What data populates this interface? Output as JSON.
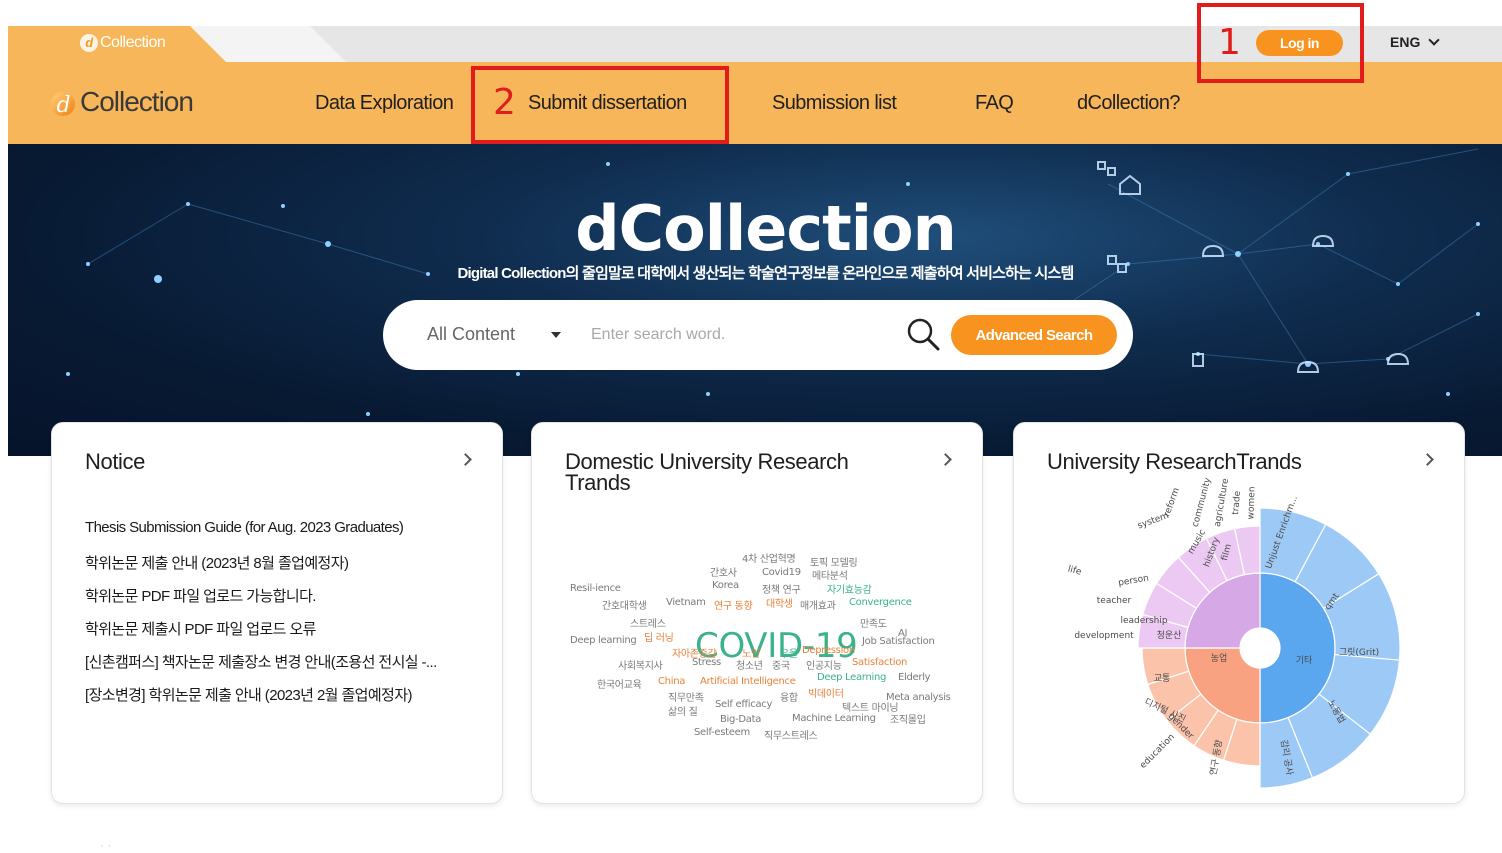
{
  "header": {
    "top_logo": "Collection",
    "login_label": "Log in",
    "language": "ENG"
  },
  "nav": {
    "brand": "Collection",
    "items": [
      "Data Exploration",
      "Submit dissertation",
      "Submission list",
      "FAQ",
      "dCollection?"
    ]
  },
  "annotations": [
    {
      "number": "1",
      "target": "Log in"
    },
    {
      "number": "2",
      "target": "Submit dissertation"
    }
  ],
  "hero": {
    "title": "dCollection",
    "subtitle": "Digital Collection의 줄임말로 대학에서 생산되는 학술연구정보를 온라인으로 제출하여 서비스하는 시스템"
  },
  "search": {
    "scope": "All Content",
    "placeholder": "Enter search word.",
    "advanced_label": "Advanced Search"
  },
  "cards": {
    "notice": {
      "title": "Notice",
      "items": [
        "Thesis Submission Guide (for Aug. 2023 Graduates)",
        "학위논문 제출 안내 (2023년 8월 졸업예정자)",
        "학위논문 PDF 파일 업로드 가능합니다.",
        "학위논문 제출시 PDF 파일 업로드 오류",
        "[신촌캠퍼스] 책자논문 제출장소 변경 안내(조용선 전시실 -...",
        "[장소변경] 학위논문 제출 안내 (2023년 2월 졸업예정자)"
      ]
    },
    "domestic": {
      "title": "Domestic University Research Trands",
      "words": [
        {
          "text": "COVID-19",
          "color": "#3bb28a",
          "size": "big"
        },
        {
          "text": "4차 산업혁명",
          "color": "#7a7a7a"
        },
        {
          "text": "토픽 모델링",
          "color": "#7a7a7a"
        },
        {
          "text": "간호사",
          "color": "#7a7a7a"
        },
        {
          "text": "Covid19",
          "color": "#7a7a7a"
        },
        {
          "text": "메타분석",
          "color": "#7a7a7a"
        },
        {
          "text": "Resil-ience",
          "color": "#7a7a7a"
        },
        {
          "text": "Korea",
          "color": "#7a7a7a"
        },
        {
          "text": "정책 연구",
          "color": "#7a7a7a"
        },
        {
          "text": "자기효능감",
          "color": "#3bb28a"
        },
        {
          "text": "간호대학생",
          "color": "#7a7a7a"
        },
        {
          "text": "Vietnam",
          "color": "#7a7a7a"
        },
        {
          "text": "연구 동향",
          "color": "#e8823c"
        },
        {
          "text": "대학생",
          "color": "#e8823c"
        },
        {
          "text": "매개효과",
          "color": "#7a7a7a"
        },
        {
          "text": "Convergence",
          "color": "#3bb28a"
        },
        {
          "text": "스트레스",
          "color": "#7a7a7a"
        },
        {
          "text": "만족도",
          "color": "#7a7a7a"
        },
        {
          "text": "Deep learning",
          "color": "#7a7a7a"
        },
        {
          "text": "딥 러닝",
          "color": "#e8823c"
        },
        {
          "text": "AI",
          "color": "#7a7a7a"
        },
        {
          "text": "Job Satisfaction",
          "color": "#7a7a7a"
        },
        {
          "text": "자아존중감",
          "color": "#e8823c"
        },
        {
          "text": "노인",
          "color": "#e8823c"
        },
        {
          "text": "우울",
          "color": "#3bb28a"
        },
        {
          "text": "Depression",
          "color": "#e8823c"
        },
        {
          "text": "사회복지사",
          "color": "#7a7a7a"
        },
        {
          "text": "Stress",
          "color": "#7a7a7a"
        },
        {
          "text": "청소년",
          "color": "#7a7a7a"
        },
        {
          "text": "중국",
          "color": "#7a7a7a"
        },
        {
          "text": "인공지능",
          "color": "#7a7a7a"
        },
        {
          "text": "Satisfaction",
          "color": "#e8823c"
        },
        {
          "text": "한국어교육",
          "color": "#7a7a7a"
        },
        {
          "text": "China",
          "color": "#e8823c"
        },
        {
          "text": "Artificial Intelligence",
          "color": "#e8823c"
        },
        {
          "text": "Deep Learning",
          "color": "#3bb28a"
        },
        {
          "text": "Elderly",
          "color": "#7a7a7a"
        },
        {
          "text": "직무만족",
          "color": "#7a7a7a"
        },
        {
          "text": "융합",
          "color": "#7a7a7a"
        },
        {
          "text": "빅데이터",
          "color": "#e8823c"
        },
        {
          "text": "삶의 질",
          "color": "#7a7a7a"
        },
        {
          "text": "Self efficacy",
          "color": "#7a7a7a"
        },
        {
          "text": "텍스트 마이닝",
          "color": "#7a7a7a"
        },
        {
          "text": "Meta analysis",
          "color": "#7a7a7a"
        },
        {
          "text": "Big-Data",
          "color": "#7a7a7a"
        },
        {
          "text": "Machine Learning",
          "color": "#7a7a7a"
        },
        {
          "text": "조직몰입",
          "color": "#7a7a7a"
        },
        {
          "text": "Self-esteem",
          "color": "#7a7a7a"
        },
        {
          "text": "직무스트레스",
          "color": "#7a7a7a"
        }
      ]
    },
    "university": {
      "title": "University ResearchTrands",
      "labels": [
        "Unjust Enrichm...",
        "qmt",
        "그릿(Grit)",
        "노동법",
        "감리 공사",
        "연구 동향",
        "기타",
        "농업",
        "청운산",
        "교통",
        "디지털 사진",
        "gender",
        "person",
        "leadership",
        "teacher",
        "education",
        "development",
        "reform",
        "community",
        "agriculture",
        "trade",
        "women",
        "music",
        "system",
        "life",
        "history",
        "film"
      ]
    }
  },
  "colors": {
    "orange_bar": "#f7b65a",
    "accent": "#f7931e",
    "annotation": "#e21b1b"
  }
}
